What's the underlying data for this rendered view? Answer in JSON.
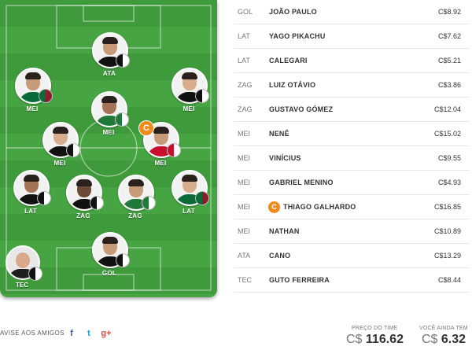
{
  "lineup": [
    {
      "position": "ATA",
      "name": "CANO",
      "price": "C$13.29",
      "crest": [
        "#111111",
        "#ffffff"
      ],
      "skin": "#c89b78"
    },
    {
      "position": "MEI",
      "name": "NATHAN",
      "price": "C$10.89",
      "crest": [
        "#0a6b3a",
        "#8b1c2b"
      ],
      "skin": "#c89b78"
    },
    {
      "position": "MEI",
      "name": "NENÊ",
      "price": "C$15.02",
      "crest": [
        "#111111",
        "#ffffff"
      ],
      "skin": "#d7ad8e"
    },
    {
      "position": "MEI",
      "name": "GABRIEL MENINO",
      "price": "C$4.93",
      "crest": [
        "#1f7a3a",
        "#ffffff"
      ],
      "skin": "#a57355"
    },
    {
      "position": "MEI",
      "name": "VINÍCIUS",
      "price": "C$9.55",
      "crest": [
        "#111111",
        "#ffffff"
      ],
      "skin": "#d7ad8e"
    },
    {
      "position": "MEI",
      "name": "THIAGO GALHARDO",
      "price": "C$16.85",
      "crest": [
        "#c8102e",
        "#ffffff"
      ],
      "skin": "#c89b78",
      "captain": true
    },
    {
      "position": "LAT",
      "name": "YAGO PIKACHU",
      "price": "C$7.62",
      "crest": [
        "#111111",
        "#ffffff"
      ],
      "skin": "#a57355"
    },
    {
      "position": "ZAG",
      "name": "LUIZ OTÁVIO",
      "price": "C$3.86",
      "crest": [
        "#111111",
        "#ffffff"
      ],
      "skin": "#6d4a35"
    },
    {
      "position": "ZAG",
      "name": "GUSTAVO GÓMEZ",
      "price": "C$12.04",
      "crest": [
        "#1f7a3a",
        "#ffffff"
      ],
      "skin": "#c89b78"
    },
    {
      "position": "LAT",
      "name": "CALEGARI",
      "price": "C$5.21",
      "crest": [
        "#0a6b3a",
        "#8b1c2b"
      ],
      "skin": "#d7ad8e"
    },
    {
      "position": "GOL",
      "name": "JOÃO PAULO",
      "price": "C$8.92",
      "crest": [
        "#111111",
        "#ffffff"
      ],
      "skin": "#c89b78"
    }
  ],
  "coach": {
    "position": "TEC",
    "name": "GUTO FERREIRA",
    "price": "C$8.44"
  },
  "roster": [
    {
      "position": "GOL",
      "name": "JOÃO PAULO",
      "price": "C$8.92"
    },
    {
      "position": "LAT",
      "name": "YAGO PIKACHU",
      "price": "C$7.62"
    },
    {
      "position": "LAT",
      "name": "CALEGARI",
      "price": "C$5.21"
    },
    {
      "position": "ZAG",
      "name": "LUIZ OTÁVIO",
      "price": "C$3.86"
    },
    {
      "position": "ZAG",
      "name": "GUSTAVO GÓMEZ",
      "price": "C$12.04"
    },
    {
      "position": "MEI",
      "name": "NENÊ",
      "price": "C$15.02"
    },
    {
      "position": "MEI",
      "name": "VINÍCIUS",
      "price": "C$9.55"
    },
    {
      "position": "MEI",
      "name": "GABRIEL MENINO",
      "price": "C$4.93"
    },
    {
      "position": "MEI",
      "name": "THIAGO GALHARDO",
      "price": "C$16.85",
      "captain": true
    },
    {
      "position": "MEI",
      "name": "NATHAN",
      "price": "C$10.89"
    },
    {
      "position": "ATA",
      "name": "CANO",
      "price": "C$13.29"
    },
    {
      "position": "TEC",
      "name": "GUTO FERREIRA",
      "price": "C$8.44"
    }
  ],
  "captain_symbol": "C",
  "footer": {
    "share_text": "AVISE AOS AMIGOS",
    "social": {
      "facebook": "f",
      "twitter": "t",
      "googleplus": "g+"
    },
    "team_price_label": "PREÇO DO TIME",
    "team_price_currency": "C$",
    "team_price_value": "116.62",
    "remaining_label": "VOCÊ AINDA TEM",
    "remaining_currency": "C$",
    "remaining_value": "6.32"
  },
  "colors": {
    "pitch": "#3f9a3c",
    "captain": "#f08a1a",
    "facebook": "#3b5998",
    "twitter": "#1da1f2",
    "googleplus": "#dd4b39"
  }
}
